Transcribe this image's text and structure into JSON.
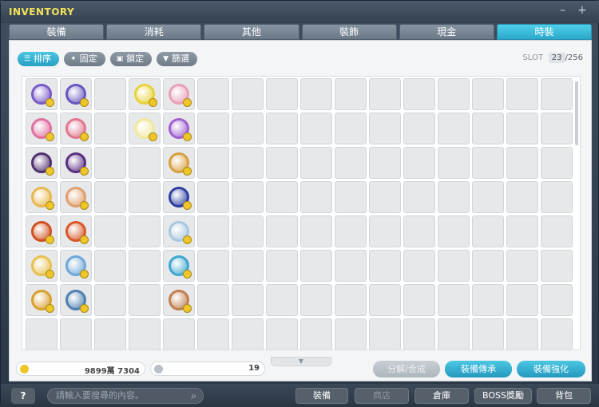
{
  "window": {
    "title": "INVENTORY",
    "minimize": "–",
    "close": "+"
  },
  "tabs": [
    "裝備",
    "消耗",
    "其他",
    "裝飾",
    "現金",
    "時裝"
  ],
  "active_tab": 5,
  "toolbar": {
    "sort": "排序",
    "fix": "固定",
    "lock": "鎖定",
    "filter": "篩選"
  },
  "slot": {
    "label": "SLOT",
    "used": "23",
    "total": "/256"
  },
  "currency": {
    "mesos": "9899萬 7304",
    "points": "19"
  },
  "actions": {
    "disassemble": "分解/合成",
    "transfer": "裝備傳承",
    "enhance": "裝備強化"
  },
  "bottom": {
    "help": "?",
    "search_placeholder": "請輸入要搜尋的內容。",
    "equip": "裝備",
    "shop": "商店",
    "storage": "倉庫",
    "boss": "BOSS獎勵",
    "bag": "背包"
  },
  "items": [
    {
      "r": 0,
      "c": 0,
      "color": "#7a5ac8"
    },
    {
      "r": 0,
      "c": 1,
      "color": "#6a58c0"
    },
    {
      "r": 0,
      "c": 3,
      "color": "#e8d23a"
    },
    {
      "r": 0,
      "c": 4,
      "color": "#e8a0b8"
    },
    {
      "r": 1,
      "c": 0,
      "color": "#e070a0"
    },
    {
      "r": 1,
      "c": 1,
      "color": "#e07890"
    },
    {
      "r": 1,
      "c": 3,
      "color": "#f0e8a0"
    },
    {
      "r": 1,
      "c": 4,
      "color": "#a060d0"
    },
    {
      "r": 2,
      "c": 0,
      "color": "#503070"
    },
    {
      "r": 2,
      "c": 1,
      "color": "#5a3080"
    },
    {
      "r": 2,
      "c": 4,
      "color": "#d8a040"
    },
    {
      "r": 3,
      "c": 0,
      "color": "#e8b850"
    },
    {
      "r": 3,
      "c": 1,
      "color": "#e0a070"
    },
    {
      "r": 3,
      "c": 4,
      "color": "#3040a0"
    },
    {
      "r": 4,
      "c": 0,
      "color": "#d05020"
    },
    {
      "r": 4,
      "c": 1,
      "color": "#d85828"
    },
    {
      "r": 4,
      "c": 4,
      "color": "#a8c8e0"
    },
    {
      "r": 5,
      "c": 0,
      "color": "#e8c050"
    },
    {
      "r": 5,
      "c": 1,
      "color": "#70a8d8"
    },
    {
      "r": 5,
      "c": 4,
      "color": "#40a8d0"
    },
    {
      "r": 6,
      "c": 0,
      "color": "#d8a030"
    },
    {
      "r": 6,
      "c": 1,
      "color": "#5080b0"
    },
    {
      "r": 6,
      "c": 4,
      "color": "#c08050"
    }
  ]
}
